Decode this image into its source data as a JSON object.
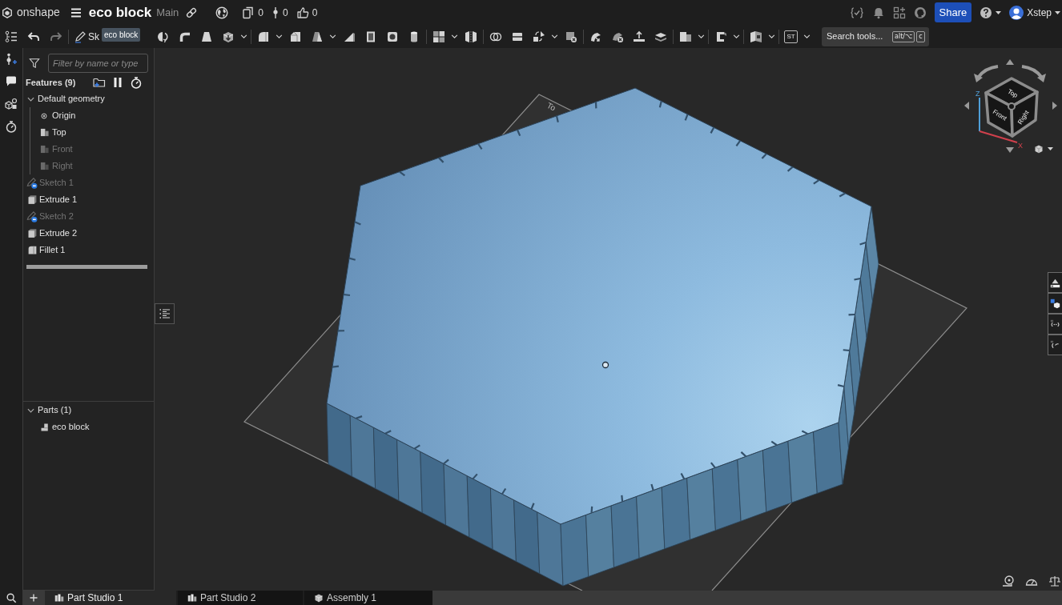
{
  "header": {
    "logo_text": "onshape",
    "document_title": "eco block",
    "workspace": "Main",
    "counters": [
      {
        "kind": "versions",
        "value": "0"
      },
      {
        "kind": "branches",
        "value": "0"
      },
      {
        "kind": "likes",
        "value": "0"
      }
    ],
    "share_button": "Share",
    "user_name": "Xstep"
  },
  "toolbar": {
    "sketch_label": "Sk",
    "tooltip": "eco block",
    "custom_feature_label": "ST",
    "search": {
      "placeholder": "Search tools...",
      "shortcut_keys": [
        "alt/⌥",
        "c"
      ]
    }
  },
  "feature_panel": {
    "filter": {
      "placeholder": "Filter by name or type"
    },
    "heading": "Features (9)",
    "tree": [
      {
        "label": "Default geometry",
        "kind": "group",
        "hidden": false,
        "expanded": true,
        "children": [
          {
            "label": "Origin",
            "kind": "origin",
            "hidden": false
          },
          {
            "label": "Top",
            "kind": "plane",
            "hidden": false
          },
          {
            "label": "Front",
            "kind": "plane",
            "hidden": true
          },
          {
            "label": "Right",
            "kind": "plane",
            "hidden": true
          }
        ]
      },
      {
        "label": "Sketch 1",
        "kind": "sketch",
        "hidden": true
      },
      {
        "label": "Extrude 1",
        "kind": "extrude",
        "hidden": false
      },
      {
        "label": "Sketch 2",
        "kind": "sketch",
        "hidden": true
      },
      {
        "label": "Extrude 2",
        "kind": "extrude",
        "hidden": false
      },
      {
        "label": "Fillet 1",
        "kind": "fillet",
        "hidden": false
      }
    ],
    "parts": {
      "heading": "Parts (1)",
      "expanded": true,
      "items": [
        {
          "label": "eco block",
          "kind": "part"
        }
      ]
    }
  },
  "viewport": {
    "plane_label": "To",
    "view_cube": {
      "faces": [
        "Top",
        "Front",
        "Right"
      ],
      "axes": [
        {
          "label": "Z",
          "color": "#4f9fd8"
        },
        {
          "label": "X",
          "color": "#d0404c"
        }
      ]
    }
  },
  "tabs": [
    {
      "label": "Part Studio 1",
      "kind": "part_studio",
      "selected": true
    },
    {
      "label": "Part Studio 2",
      "kind": "part_studio",
      "selected": false
    },
    {
      "label": "Assembly 1",
      "kind": "assembly",
      "selected": false
    }
  ]
}
